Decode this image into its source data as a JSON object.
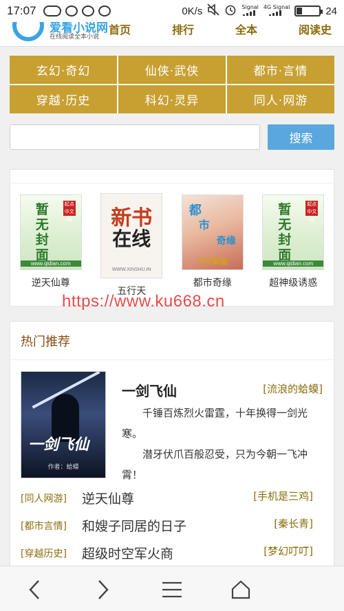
{
  "status": {
    "time": "17:07",
    "speed": "0K/s",
    "signal_label_1": "Signal",
    "signal_label_2": "4G Signal",
    "battery_percent": 24,
    "battery_text": "24"
  },
  "header": {
    "logo_main": "爱看小说网",
    "logo_sub": "在线阅读全本小说",
    "nav": [
      "首页",
      "排行",
      "全本",
      "阅读史"
    ]
  },
  "categories": [
    "玄幻·奇幻",
    "仙侠·武侠",
    "都市·言情",
    "穿越·历史",
    "科幻·灵异",
    "同人·网游"
  ],
  "search": {
    "placeholder": "",
    "button": "搜索"
  },
  "shelf": {
    "books": [
      {
        "title": "逆天仙尊",
        "cover": "nocover"
      },
      {
        "title": "五行天",
        "cover": "new"
      },
      {
        "title": "都市奇缘",
        "cover": "urban"
      },
      {
        "title": "超神级诱惑",
        "cover": "nocover"
      }
    ],
    "nocover_text": "暂无封面",
    "nocover_seal": "起点中文网",
    "nocover_url": "www.qidian.com",
    "new_line1": "新书",
    "new_line2": "在线",
    "new_line3": "WWW.XINSHU.IN",
    "urban_line1": "都",
    "urban_line2": "市",
    "urban_line3": "奇缘",
    "urban_author": "贝贝熊猫"
  },
  "watermark": "https://www.ku668.cn",
  "hot": {
    "title": "热门推荐",
    "feature": {
      "name": "一剑飞仙",
      "author": "[流浪的蛤蟆]",
      "desc": [
        "千锤百炼烈火雷霆，十年换得一剑光寒。",
        "潜牙伏爪百般忍受，只为今朝一飞冲霄！"
      ],
      "cover_title": "一剑飞仙",
      "cover_author": "作者：蛤蟆"
    },
    "rows": [
      {
        "tag": "[同人网游]",
        "title": "逆天仙尊",
        "author": "[手机是三鸡]"
      },
      {
        "tag": "[都市言情]",
        "title": "和嫂子同居的日子",
        "author": "[秦长青]"
      },
      {
        "tag": "[穿越历史]",
        "title": "超级时空军火商",
        "author": "[梦幻叮叮]"
      }
    ]
  },
  "bottom_nav": [
    "back-icon",
    "forward-icon",
    "menu-icon",
    "home-icon"
  ]
}
